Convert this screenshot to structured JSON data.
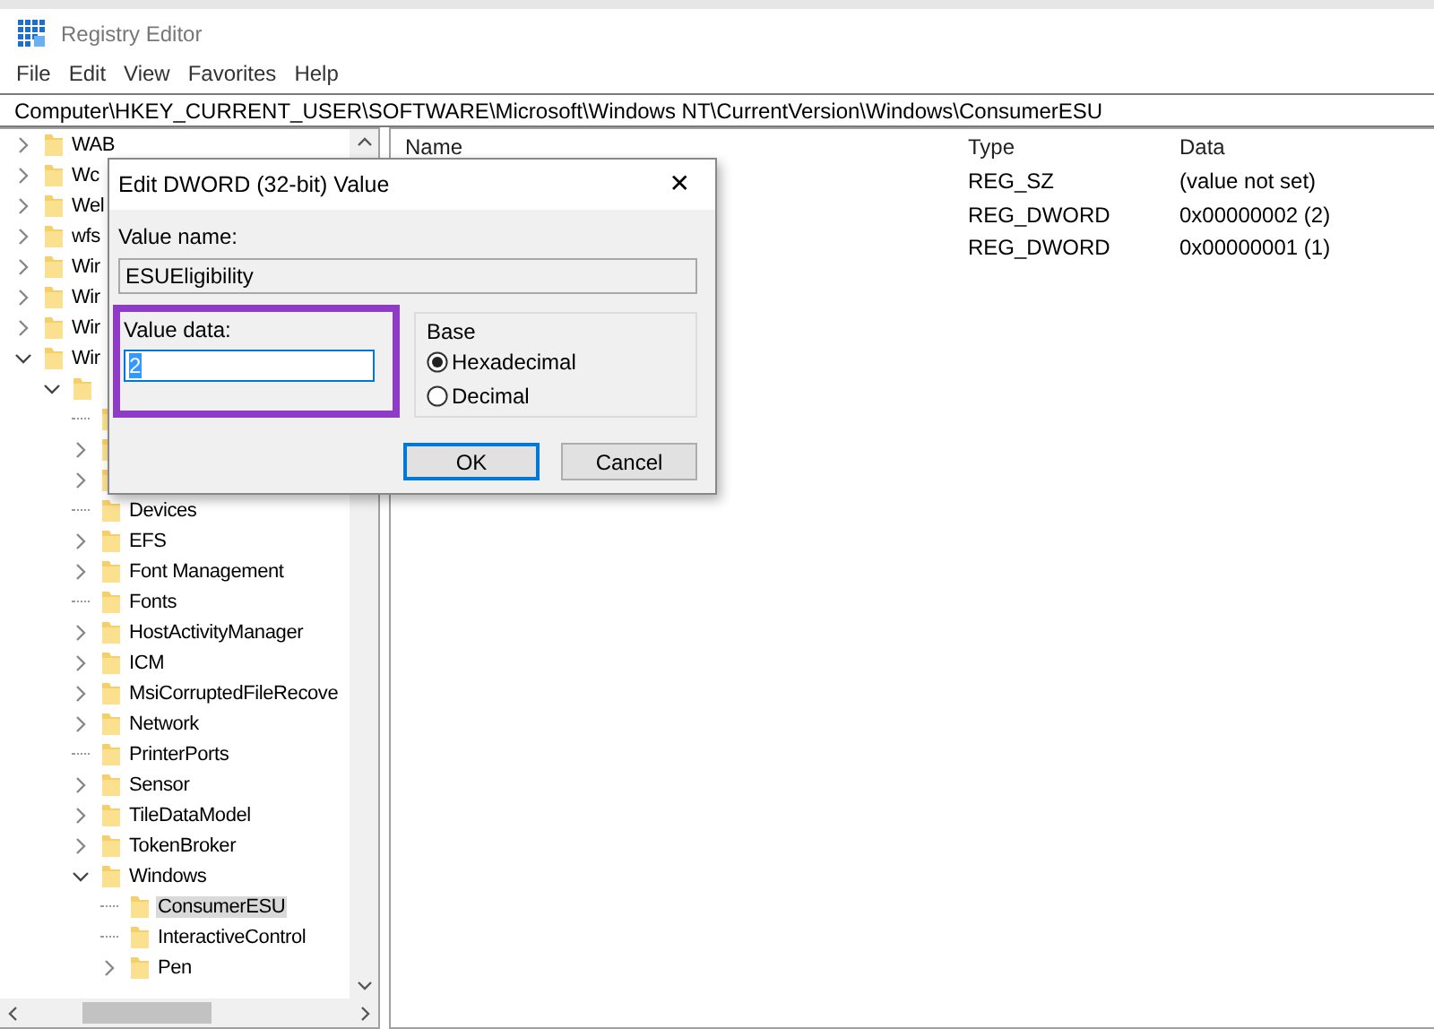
{
  "window": {
    "title": "Registry Editor"
  },
  "menu": [
    "File",
    "Edit",
    "View",
    "Favorites",
    "Help"
  ],
  "address": "Computer\\HKEY_CURRENT_USER\\SOFTWARE\\Microsoft\\Windows NT\\CurrentVersion\\Windows\\ConsumerESU",
  "tree": [
    {
      "label": "WAB",
      "kind": "collapsed",
      "selected": false
    },
    {
      "label": "Wc",
      "kind": "collapsed",
      "selected": false
    },
    {
      "label": "Wel",
      "kind": "collapsed",
      "selected": false
    },
    {
      "label": "wfs",
      "kind": "collapsed",
      "selected": false
    },
    {
      "label": "Wir",
      "kind": "collapsed",
      "selected": false
    },
    {
      "label": "Wir",
      "kind": "collapsed",
      "selected": false
    },
    {
      "label": "Wir",
      "kind": "collapsed",
      "selected": false
    },
    {
      "label": "Wir",
      "kind": "expanded",
      "selected": false,
      "children": [
        {
          "kind": "expanded",
          "children": [
            {
              "kind": "leaf"
            },
            {
              "kind": "collapsed"
            },
            {
              "kind": "collapsed"
            },
            {
              "label": "Devices",
              "kind": "leaf",
              "selected": false
            },
            {
              "label": "EFS",
              "kind": "collapsed",
              "selected": false
            },
            {
              "label": "Font Management",
              "kind": "collapsed",
              "selected": false
            },
            {
              "label": "Fonts",
              "kind": "leaf",
              "selected": false
            },
            {
              "label": "HostActivityManager",
              "kind": "collapsed",
              "selected": false
            },
            {
              "label": "ICM",
              "kind": "collapsed",
              "selected": false
            },
            {
              "label": "MsiCorruptedFileRecove",
              "kind": "collapsed",
              "selected": false
            },
            {
              "label": "Network",
              "kind": "collapsed",
              "selected": false
            },
            {
              "label": "PrinterPorts",
              "kind": "leaf",
              "selected": false
            },
            {
              "label": "Sensor",
              "kind": "collapsed",
              "selected": false
            },
            {
              "label": "TileDataModel",
              "kind": "collapsed",
              "selected": false
            },
            {
              "label": "TokenBroker",
              "kind": "collapsed",
              "selected": false
            },
            {
              "label": "Windows",
              "kind": "expanded",
              "selected": false,
              "children": [
                {
                  "label": "ConsumerESU",
                  "kind": "leaf",
                  "selected": true
                },
                {
                  "label": "InteractiveControl",
                  "kind": "leaf",
                  "selected": false
                },
                {
                  "label": "Pen",
                  "kind": "collapsed",
                  "selected": false
                }
              ]
            }
          ]
        }
      ]
    }
  ],
  "values": {
    "columns": [
      "Name",
      "Type",
      "Data"
    ],
    "rows": [
      {
        "type": "REG_SZ",
        "data": "(value not set)"
      },
      {
        "type": "REG_DWORD",
        "data": "0x00000002 (2)"
      },
      {
        "type": "REG_DWORD",
        "data": "0x00000001 (1)"
      }
    ]
  },
  "dialog": {
    "title": "Edit DWORD (32-bit) Value",
    "close": "✕",
    "value_name_label": "Value name:",
    "value_name": "ESUEligibility",
    "value_data_label": "Value data:",
    "value_data": "2",
    "highlight": true,
    "base_label": "Base",
    "base_options": [
      {
        "label": "Hexadecimal",
        "selected": true
      },
      {
        "label": "Decimal",
        "selected": false
      }
    ],
    "buttons": [
      {
        "label": "OK",
        "default": true
      },
      {
        "label": "Cancel",
        "default": false
      }
    ]
  }
}
